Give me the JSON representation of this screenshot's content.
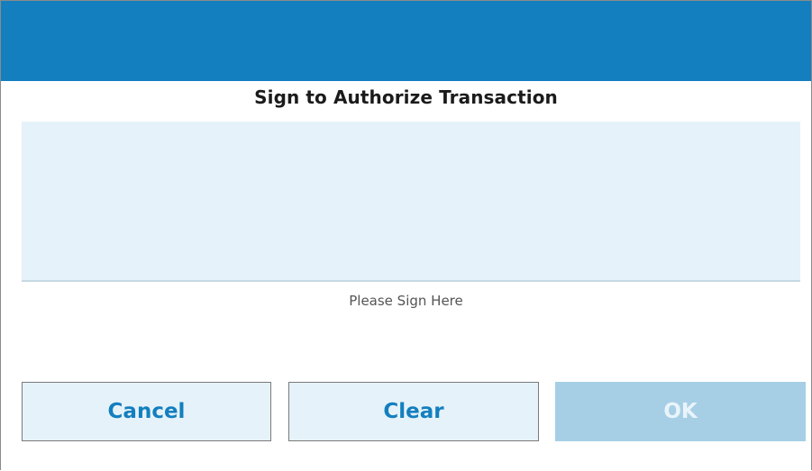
{
  "dialog": {
    "title": "Sign to Authorize Transaction",
    "signature_hint": "Please Sign Here"
  },
  "buttons": {
    "cancel_label": "Cancel",
    "clear_label": "Clear",
    "ok_label": "OK"
  },
  "colors": {
    "header": "#137fbf",
    "signature_area": "#e6f2f9",
    "button_text": "#137fbf",
    "ok_disabled": "#a6cfe6"
  }
}
